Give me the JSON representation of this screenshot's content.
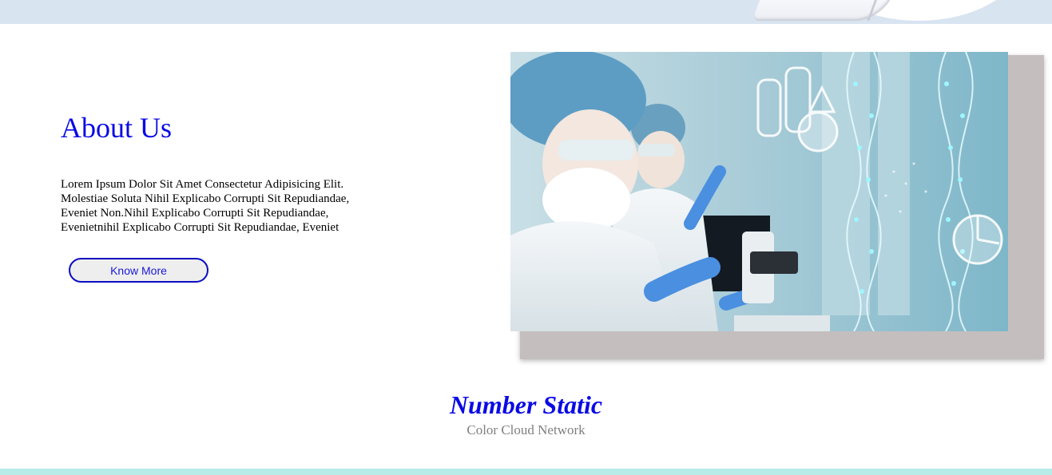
{
  "about": {
    "title": "About Us",
    "body": "Lorem Ipsum Dolor Sit Amet Consectetur Adipisicing Elit. Molestiae Soluta Nihil Explicabo Corrupti Sit Repudiandae, Eveniet Non.Nihil Explicabo Corrupti Sit Repudiandae, Evenietnihil Explicabo Corrupti Sit Repudiandae, Eveniet",
    "button_label": "Know More"
  },
  "stats": {
    "title": "Number Static",
    "subtitle": "Color Cloud Network"
  },
  "colors": {
    "accent": "#0a0ae6",
    "top_band": "#d9e4f1",
    "bottom_band": "#b7ece9",
    "photo_shadow": "#c4bebe",
    "subtitle_gray": "#808080"
  }
}
